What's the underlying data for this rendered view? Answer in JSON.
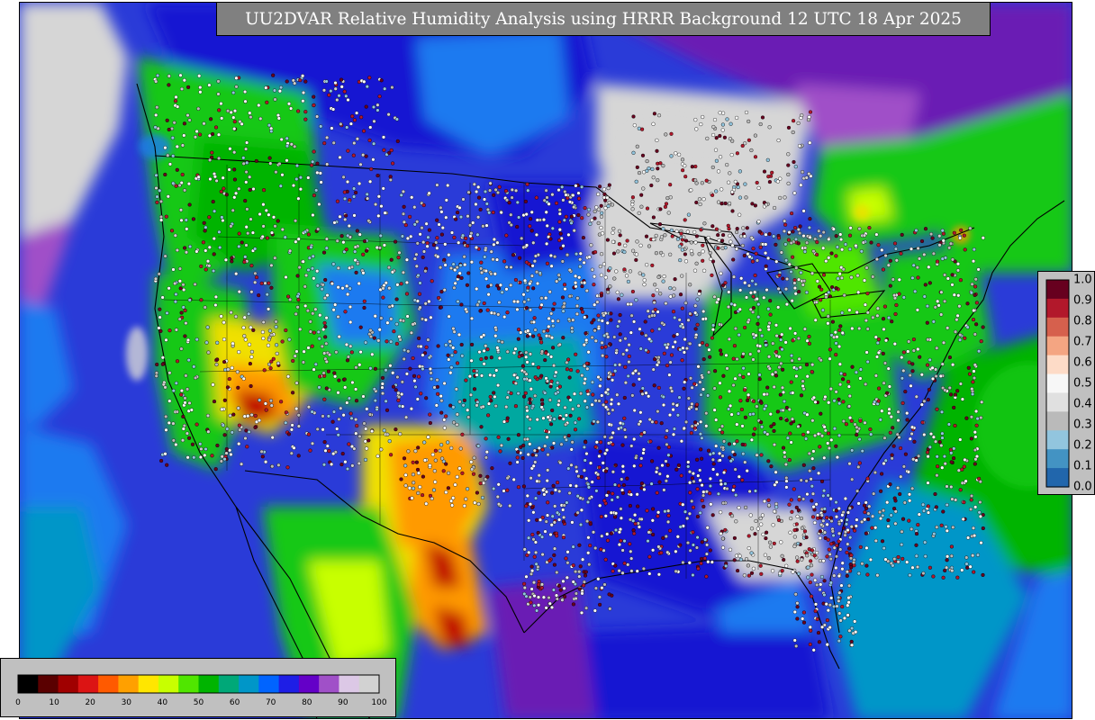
{
  "title": "UU2DVAR Relative Humidity Analysis using HRRR Background 12 UTC 18 Apr 2025",
  "rh_colorbar": {
    "ticks": [
      "0",
      "10",
      "20",
      "30",
      "40",
      "50",
      "60",
      "70",
      "80",
      "90",
      "100"
    ],
    "colors": [
      "#000000",
      "#5a0000",
      "#a00000",
      "#dc1414",
      "#ff5a00",
      "#ffa000",
      "#ffe600",
      "#c8ff00",
      "#50e600",
      "#00b400",
      "#00a878",
      "#0096c8",
      "#0064ff",
      "#1e1ee6",
      "#6400c8",
      "#a050c8",
      "#dcc8e6",
      "#d2d2d2"
    ]
  },
  "ob_colorbar": {
    "ticks": [
      "1.0",
      "0.9",
      "0.8",
      "0.7",
      "0.6",
      "0.5",
      "0.4",
      "0.3",
      "0.2",
      "0.1",
      "0.0"
    ],
    "colors": [
      "#67001f",
      "#b2182b",
      "#d6604d",
      "#f4a582",
      "#fddbc7",
      "#f7f7f7",
      "#e0e0e0",
      "#bababa",
      "#92c5de",
      "#4393c3",
      "#2166ac"
    ]
  },
  "map": {
    "region": "Contiguous United States, southern Canada and northern Mexico",
    "field": "relative humidity analysis",
    "colors": {
      "ocean": "#2a3bd8",
      "very_dry": "#c00000",
      "dry": "#ff9a00",
      "moderate": "#f0e000",
      "green": "#14c814",
      "teal": "#00a8a0",
      "blue": "#1e7af0",
      "deep_blue": "#1414d2",
      "purple": "#6a1eb4",
      "saturated": "#d6d6d6",
      "boundary": "#000000"
    }
  }
}
